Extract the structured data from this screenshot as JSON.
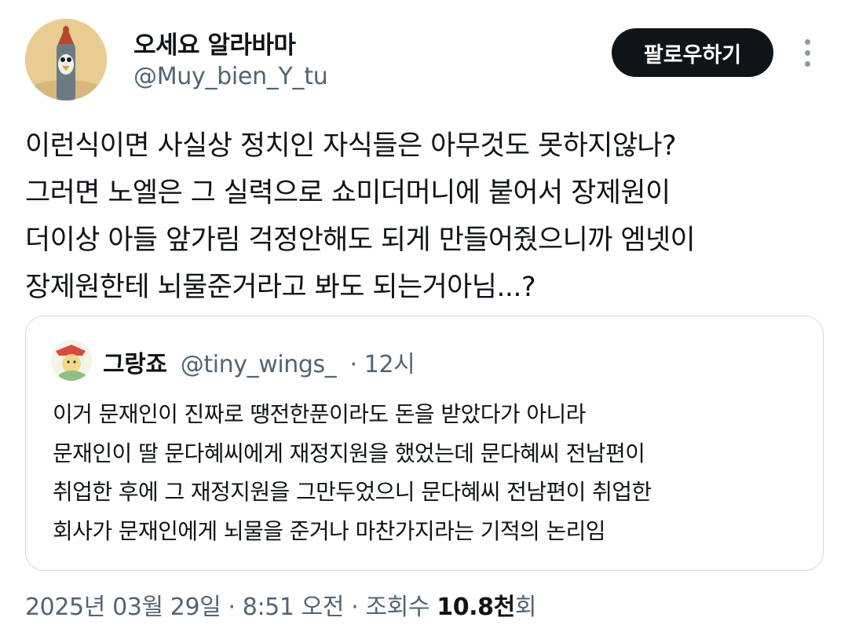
{
  "author": {
    "name": "오세요 알라바마",
    "handle": "@Muy_bien_Y_tu",
    "follow_label": "팔로우하기"
  },
  "tweet": {
    "lines": [
      "이런식이면 사실상 정치인 자식들은 아무것도 못하지않나?",
      "그러면 노엘은 그 실력으로 쇼미더머니에 붙어서 장제원이",
      "더이상 아들 앞가림 걱정안해도 되게 만들어줬으니까 엠넷이",
      "장제원한테 뇌물준거라고 봐도 되는거아님...?"
    ]
  },
  "quote": {
    "name": "그랑죠",
    "handle": "@tiny_wings_",
    "time": "· 12시",
    "lines": [
      "이거 문재인이 진짜로 땡전한푼이라도 돈을 받았다가 아니라",
      "문재인이 딸 문다혜씨에게 재정지원을 했었는데 문다혜씨 전남편이",
      "취업한 후에 그 재정지원을 그만두었으니 문다혜씨 전남편이 취업한",
      "회사가 문재인에게 뇌물을 준거나 마찬가지라는 기적의 논리임"
    ]
  },
  "footer": {
    "datetime": "2025년 03월 29일 · 8:51 오전 · 조회수 ",
    "views": "10.8천",
    "views_suffix": "회"
  },
  "icons": {
    "more": "more-vertical-icon",
    "avatar": "avatar-image",
    "quote_avatar": "quote-avatar-image"
  },
  "colors": {
    "text": "#0f1419",
    "secondary": "#536471",
    "border": "#cfd9de",
    "button_bg": "#0f1419",
    "button_text": "#ffffff"
  }
}
